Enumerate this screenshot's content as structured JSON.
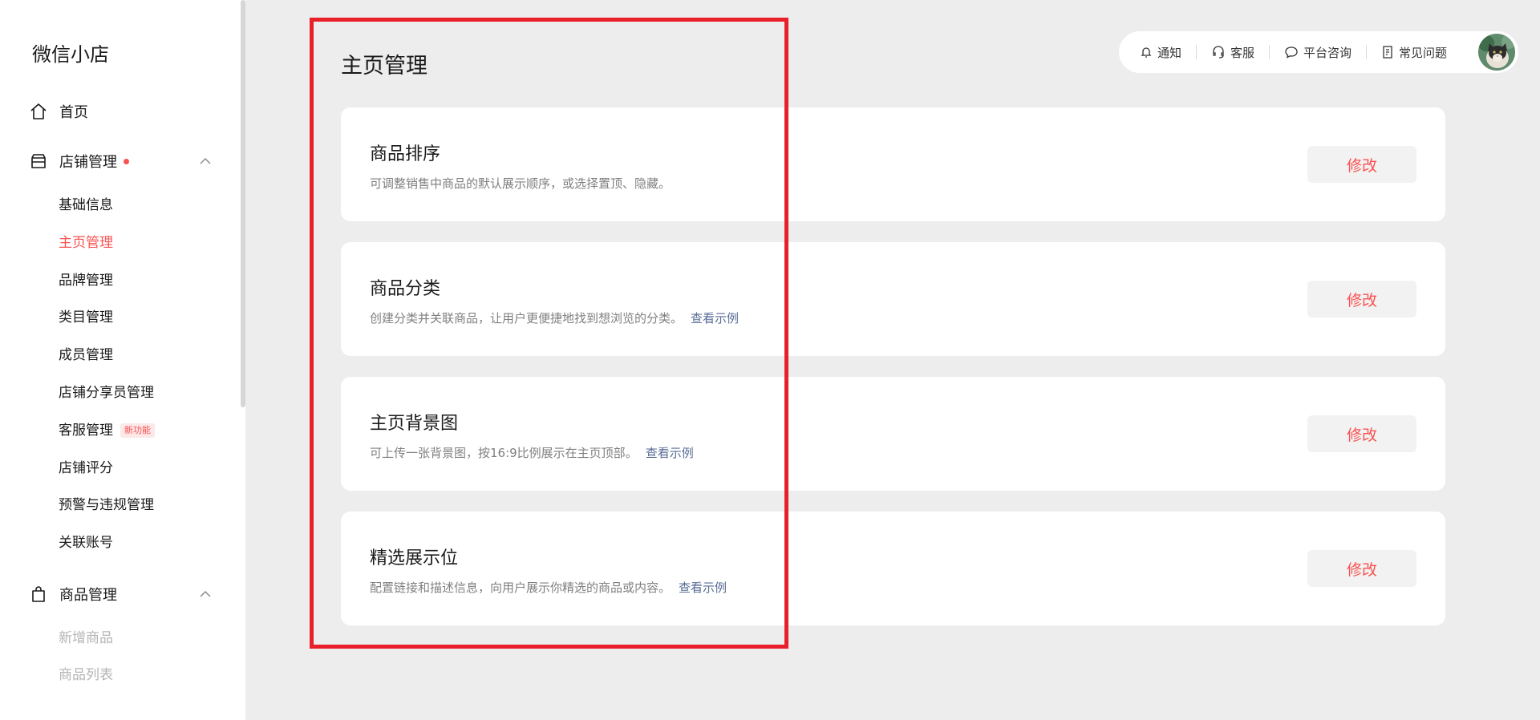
{
  "sidebar": {
    "app_title": "微信小店",
    "home": {
      "label": "首页",
      "icon": "home-icon"
    },
    "store": {
      "label": "店铺管理",
      "icon": "store-icon",
      "has_red_dot": true,
      "expanded": true,
      "items": [
        {
          "label": "基础信息"
        },
        {
          "label": "主页管理",
          "active": true
        },
        {
          "label": "品牌管理"
        },
        {
          "label": "类目管理"
        },
        {
          "label": "成员管理"
        },
        {
          "label": "店铺分享员管理"
        },
        {
          "label": "客服管理",
          "badge": "新功能"
        },
        {
          "label": "店铺评分"
        },
        {
          "label": "预警与违规管理"
        },
        {
          "label": "关联账号"
        }
      ]
    },
    "goods": {
      "label": "商品管理",
      "icon": "bag-icon",
      "expanded": true,
      "items": [
        {
          "label": "新增商品"
        },
        {
          "label": "商品列表"
        }
      ]
    }
  },
  "topbar": {
    "notify": "通知",
    "service": "客服",
    "consult": "平台咨询",
    "faq": "常见问题"
  },
  "main": {
    "page_title": "主页管理",
    "cards": [
      {
        "title": "商品排序",
        "desc": "可调整销售中商品的默认展示顺序，或选择置顶、隐藏。",
        "link": "",
        "button": "修改"
      },
      {
        "title": "商品分类",
        "desc": "创建分类并关联商品，让用户更便捷地找到想浏览的分类。",
        "link": "查看示例",
        "button": "修改"
      },
      {
        "title": "主页背景图",
        "desc": "可上传一张背景图，按16:9比例展示在主页顶部。",
        "link": "查看示例",
        "button": "修改"
      },
      {
        "title": "精选展示位",
        "desc": "配置链接和描述信息，向用户展示你精选的商品或内容。",
        "link": "查看示例",
        "button": "修改"
      }
    ]
  },
  "colors": {
    "accent": "#fa5151",
    "link": "#576b95",
    "highlight_border": "#e8202a",
    "background": "#ededed"
  }
}
